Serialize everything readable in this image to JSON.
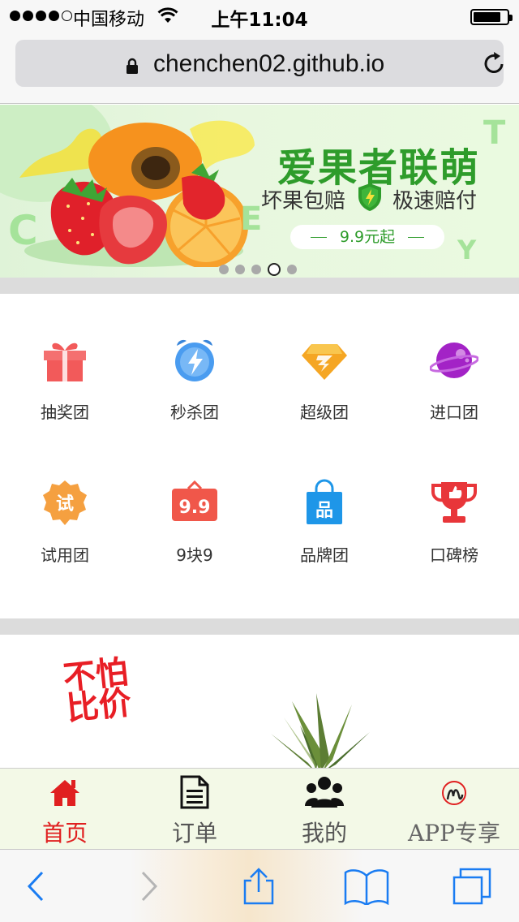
{
  "status_bar": {
    "carrier": "中国移动",
    "time": "上午11:04",
    "signal_bars": 4,
    "signal_max": 5,
    "battery_level": 0.82
  },
  "browser": {
    "url": "chenchen02.github.io",
    "icons": [
      "lock-icon",
      "reload-icon"
    ]
  },
  "banner": {
    "title": "爱果者联萌",
    "subtitle_left": "坏果包赔",
    "subtitle_right": "极速赔付",
    "price_tag": "9.9元起",
    "letters": [
      "C",
      "E",
      "T",
      "Y"
    ],
    "carousel_count": 5,
    "carousel_active_index": 3,
    "colors": {
      "title": "#2e9c2b",
      "background": "#e4f6dc"
    }
  },
  "categories": [
    {
      "label": "抽奖团",
      "icon": "gift-icon",
      "color": "#f25a5a"
    },
    {
      "label": "秒杀团",
      "icon": "alarm-clock-icon",
      "color": "#4a9cf0"
    },
    {
      "label": "超级团",
      "icon": "diamond-icon",
      "color": "#f5a623"
    },
    {
      "label": "进口团",
      "icon": "planet-icon",
      "color": "#a323c6"
    },
    {
      "label": "试用团",
      "icon": "trial-badge-icon",
      "color": "#f5a040",
      "glyph": "试"
    },
    {
      "label": "9块9",
      "icon": "price-tag-icon",
      "color": "#f0574a",
      "glyph": "9.9"
    },
    {
      "label": "品牌团",
      "icon": "shopping-bag-icon",
      "color": "#1e96e8",
      "glyph": "品"
    },
    {
      "label": "口碑榜",
      "icon": "trophy-icon",
      "color": "#e8363a"
    }
  ],
  "promo": {
    "slogan": "不怕比价",
    "colors": {
      "slogan": "#e81e25"
    }
  },
  "tab_bar": {
    "tabs": [
      {
        "label": "首页",
        "icon": "home-icon",
        "active": true
      },
      {
        "label": "订单",
        "icon": "document-icon",
        "active": false
      },
      {
        "label": "我的",
        "icon": "users-icon",
        "active": false
      },
      {
        "label": "APP专享",
        "icon": "app-logo-icon",
        "active": false
      }
    ],
    "colors": {
      "active": "#e02020",
      "inactive": "#555555"
    }
  },
  "safari_toolbar": {
    "buttons": [
      "back-icon",
      "forward-icon",
      "share-icon",
      "bookmarks-icon",
      "tabs-icon"
    ],
    "colors": {
      "tint": "#1a7cf2",
      "disabled": "#b5b5b5"
    }
  }
}
